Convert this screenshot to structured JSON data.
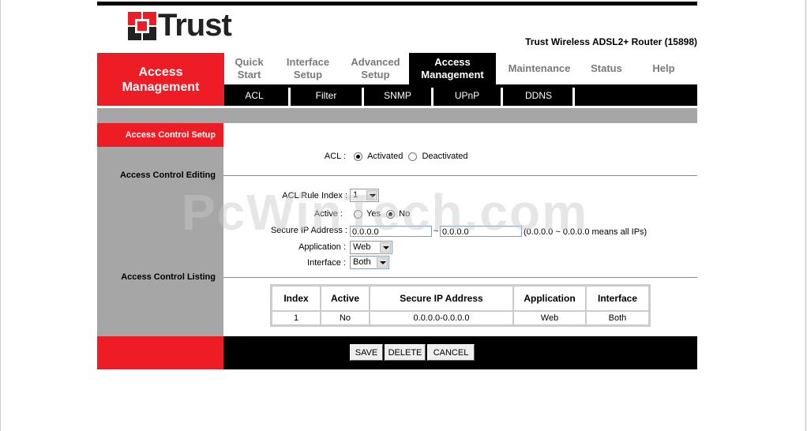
{
  "header": {
    "brand": "Trust",
    "model": "Trust Wireless ADSL2+ Router (15898)"
  },
  "sidebar_title": "Access Management",
  "tabs": [
    {
      "label": "Quick\nStart"
    },
    {
      "label": "Interface\nSetup"
    },
    {
      "label": "Advanced\nSetup"
    },
    {
      "label": "Access\nManagement",
      "active": true
    },
    {
      "label": "Maintenance"
    },
    {
      "label": "Status"
    },
    {
      "label": "Help"
    }
  ],
  "subtabs": [
    "ACL",
    "Filter",
    "SNMP",
    "UPnP",
    "DDNS"
  ],
  "sections": {
    "setup": "Access Control Setup",
    "editing": "Access Control Editing",
    "listing": "Access Control Listing"
  },
  "acl": {
    "label": "ACL :",
    "activated": "Activated",
    "deactivated": "Deactivated",
    "selected": "Activated"
  },
  "editing": {
    "rule_index_label": "ACL Rule Index :",
    "rule_index_value": "1",
    "active_label": "Active :",
    "active_yes": "Yes",
    "active_no": "No",
    "active_selected": "No",
    "secure_ip_label": "Secure IP Address :",
    "ip_start": "0.0.0.0",
    "ip_sep": "~",
    "ip_end": "0.0.0.0",
    "ip_hint": "(0.0.0.0 ~ 0.0.0.0 means all IPs)",
    "application_label": "Application :",
    "application_value": "Web",
    "interface_label": "Interface :",
    "interface_value": "Both"
  },
  "listing": {
    "headers": [
      "Index",
      "Active",
      "Secure IP Address",
      "Application",
      "Interface"
    ],
    "rows": [
      [
        "1",
        "No",
        "0.0.0.0-0.0.0.0",
        "Web",
        "Both"
      ]
    ]
  },
  "buttons": {
    "save": "SAVE",
    "delete": "DELETE",
    "cancel": "CANCEL"
  },
  "watermark": "PcWinTech.com",
  "colors": {
    "brand_red": "#ee1c25",
    "sidebar_gray": "#a6a6a6",
    "nav_black": "#000000"
  }
}
